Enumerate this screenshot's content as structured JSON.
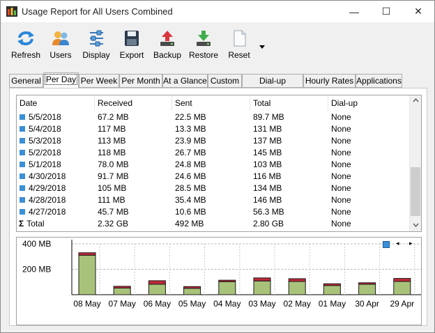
{
  "window": {
    "title": "Usage Report for All Users Combined",
    "minimize": "—",
    "maximize": "☐",
    "close": "✕"
  },
  "toolbar": {
    "refresh": "Refresh",
    "users": "Users",
    "display": "Display",
    "export": "Export",
    "backup": "Backup",
    "restore": "Restore",
    "reset": "Reset"
  },
  "tabs": [
    "General",
    "Per Day",
    "Per Week",
    "Per Month",
    "At a Glance",
    "Custom",
    "Dial-up Sessions",
    "Hourly Rates",
    "Applications"
  ],
  "table": {
    "columns": [
      "Date",
      "Received",
      "Sent",
      "Total",
      "Dial-up"
    ],
    "rows": [
      [
        "5/5/2018",
        "67.2 MB",
        "22.5 MB",
        "89.7 MB",
        "None"
      ],
      [
        "5/4/2018",
        "117 MB",
        "13.3 MB",
        "131 MB",
        "None"
      ],
      [
        "5/3/2018",
        "113 MB",
        "23.9 MB",
        "137 MB",
        "None"
      ],
      [
        "5/2/2018",
        "118 MB",
        "26.7 MB",
        "145 MB",
        "None"
      ],
      [
        "5/1/2018",
        "78.0 MB",
        "24.8 MB",
        "103 MB",
        "None"
      ],
      [
        "4/30/2018",
        "91.7 MB",
        "24.6 MB",
        "116 MB",
        "None"
      ],
      [
        "4/29/2018",
        "105 MB",
        "28.5 MB",
        "134 MB",
        "None"
      ],
      [
        "4/28/2018",
        "111 MB",
        "35.4 MB",
        "146 MB",
        "None"
      ],
      [
        "4/27/2018",
        "45.7 MB",
        "10.6 MB",
        "56.3 MB",
        "None"
      ]
    ],
    "total": [
      "Total",
      "2.32 GB",
      "492 MB",
      "2.80 GB",
      "None"
    ],
    "total_icon": "Σ"
  },
  "chart_data": {
    "type": "bar",
    "categories": [
      "08 May",
      "07 May",
      "06 May",
      "05 May",
      "04 May",
      "03 May",
      "02 May",
      "01 May",
      "30 Apr",
      "29 Apr"
    ],
    "series": [
      {
        "values": [
          310,
          52,
          82,
          50,
          102,
          108,
          104,
          72,
          82,
          104
        ]
      },
      {
        "values": [
          20,
          14,
          28,
          14,
          12,
          24,
          22,
          14,
          12,
          24
        ]
      }
    ],
    "yticks": [
      "400 MB",
      "200 MB"
    ],
    "ytick_values": [
      400,
      200
    ],
    "ylim": [
      0,
      400
    ],
    "colors": {
      "received": "#a9c27a",
      "sent": "#c0283a",
      "bar_outline": "#1a1a1a"
    },
    "grid": true,
    "legend_position": "top-right"
  },
  "chart_nav": {
    "left": "◂",
    "right": "▸"
  }
}
